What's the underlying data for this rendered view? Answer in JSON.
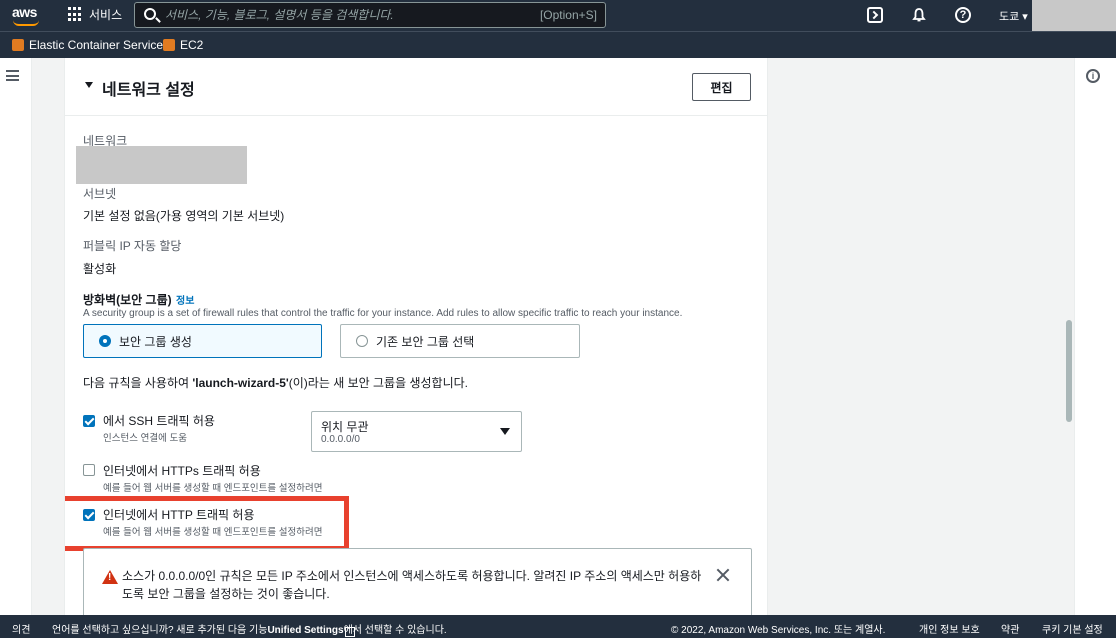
{
  "topnav": {
    "logo": "aws",
    "services_label": "서비스",
    "search_placeholder": "서비스, 기능, 블로그, 설명서 등을 검색합니다.",
    "search_shortcut": "[Option+S]",
    "region": "도쿄 ▾",
    "icons": [
      "cloudshell-icon",
      "bell-icon",
      "help-icon"
    ]
  },
  "favorites": [
    {
      "label": "Elastic Container Service"
    },
    {
      "label": "EC2"
    }
  ],
  "panel": {
    "title": "네트워크 설정",
    "edit_label": "편집",
    "network_label": "네트워크",
    "subnet_label": "서브넷",
    "subnet_value": "기본 설정 없음(가용 영역의 기본 서브넷)",
    "public_ip_label": "퍼블릭 IP 자동 할당",
    "public_ip_value": "활성화",
    "firewall_title": "방화벽(보안 그룹)",
    "firewall_info": "정보",
    "firewall_desc": "A security group is a set of firewall rules that control the traffic for your instance. Add rules to allow specific traffic to reach your instance.",
    "option_create": "보안 그룹 생성",
    "option_existing": "기존 보안 그룹 선택",
    "rule_prefix": "다음 규칙을 사용하여 ",
    "rule_name": "'launch-wizard-5'",
    "rule_suffix": "(이)라는 새 보안 그룹을 생성합니다.",
    "ssh_label": "에서 SSH 트래픽 허용",
    "ssh_desc": "인스턴스 연결에 도움",
    "ssh_checked": true,
    "ssh_source": "위치 무관",
    "ssh_source_cidr": "0.0.0.0/0",
    "https_label": "인터넷에서 HTTPs 트래픽 허용",
    "https_desc": "예를 들어 웹 서버를 생성할 때 엔드포인트를 설정하려면",
    "https_checked": false,
    "http_label": "인터넷에서 HTTP 트래픽 허용",
    "http_desc": "예를 들어 웹 서버를 생성할 때 엔드포인트를 설정하려면",
    "http_checked": true,
    "warning_text": "소스가 0.0.0.0/0인 규칙은 모든 IP 주소에서 인스턴스에 액세스하도록 허용합니다. 알려진 IP 주소의 액세스만 허용하도록 보안 그룹을 설정하는 것이 좋습니다."
  },
  "footer": {
    "feedback": "의견",
    "language_prefix": "언어를 선택하고 싶으십니까? 새로 추가된 다음 기능",
    "unified_settings": "Unified Settings",
    "language_suffix": "에서 선택할 수 있습니다.",
    "copyright": "© 2022, Amazon Web Services, Inc. 또는 계열사.",
    "privacy": "개인 정보 보호",
    "terms": "약관",
    "cookie": "쿠키 기본 설정"
  },
  "colors": {
    "nav_bg": "#232f3e",
    "accent": "#0073bb",
    "highlight_box": "#e8412e",
    "warning": "#d13212",
    "service_icon": "#e07b21"
  }
}
